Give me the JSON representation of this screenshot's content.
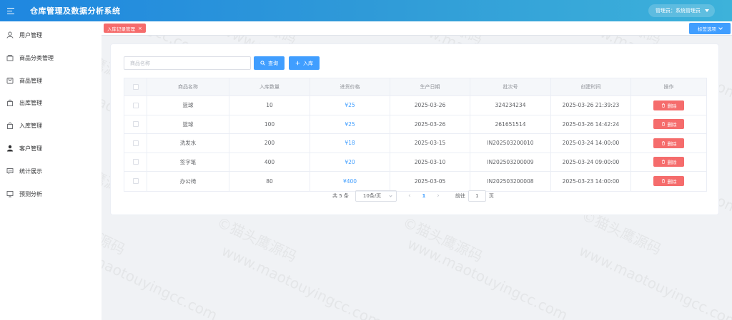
{
  "app": {
    "title": "仓库管理及数据分析系统"
  },
  "user": {
    "label": "管理员：系统管理员"
  },
  "sidebar": {
    "items": [
      {
        "label": "用户管理",
        "icon": "user-icon"
      },
      {
        "label": "商品分类管理",
        "icon": "folder-icon"
      },
      {
        "label": "商品管理",
        "icon": "box-icon"
      },
      {
        "label": "出库管理",
        "icon": "bag-icon"
      },
      {
        "label": "入库管理",
        "icon": "bag-icon"
      },
      {
        "label": "客户管理",
        "icon": "person-filled-icon"
      },
      {
        "label": "统计展示",
        "icon": "chat-chart-icon"
      },
      {
        "label": "预测分析",
        "icon": "monitor-icon"
      }
    ]
  },
  "tags": {
    "active": "入库记录管理",
    "close": "×",
    "options_label": "标签选项"
  },
  "search": {
    "placeholder": "商品名称",
    "query_label": "查询",
    "add_label": "入库"
  },
  "table": {
    "headers": [
      "商品名称",
      "入库数量",
      "进货价格",
      "生产日期",
      "批次号",
      "创建时间",
      "操作"
    ],
    "delete_label": "删除",
    "rows": [
      {
        "name": "篮球",
        "qty": "10",
        "price": "¥25",
        "date": "2025-03-26",
        "batch": "324234234",
        "created": "2025-03-26 21:39:23"
      },
      {
        "name": "篮球",
        "qty": "100",
        "price": "¥25",
        "date": "2025-03-26",
        "batch": "261651514",
        "created": "2025-03-26 14:42:24"
      },
      {
        "name": "洗发水",
        "qty": "200",
        "price": "¥18",
        "date": "2025-03-15",
        "batch": "IN202503200010",
        "created": "2025-03-24 14:00:00"
      },
      {
        "name": "签字笔",
        "qty": "400",
        "price": "¥20",
        "date": "2025-03-10",
        "batch": "IN202503200009",
        "created": "2025-03-24 09:00:00"
      },
      {
        "name": "办公椅",
        "qty": "80",
        "price": "¥400",
        "date": "2025-03-05",
        "batch": "IN202503200008",
        "created": "2025-03-23 14:00:00"
      }
    ]
  },
  "pagination": {
    "total": "共 5 条",
    "page_size": "10条/页",
    "current": "1",
    "goto_prefix": "前往",
    "goto_value": "1",
    "goto_suffix": "页"
  },
  "watermark": {
    "text_cn": "©猫头鹰源码",
    "text_url": "www.maotouyingcc.com"
  }
}
